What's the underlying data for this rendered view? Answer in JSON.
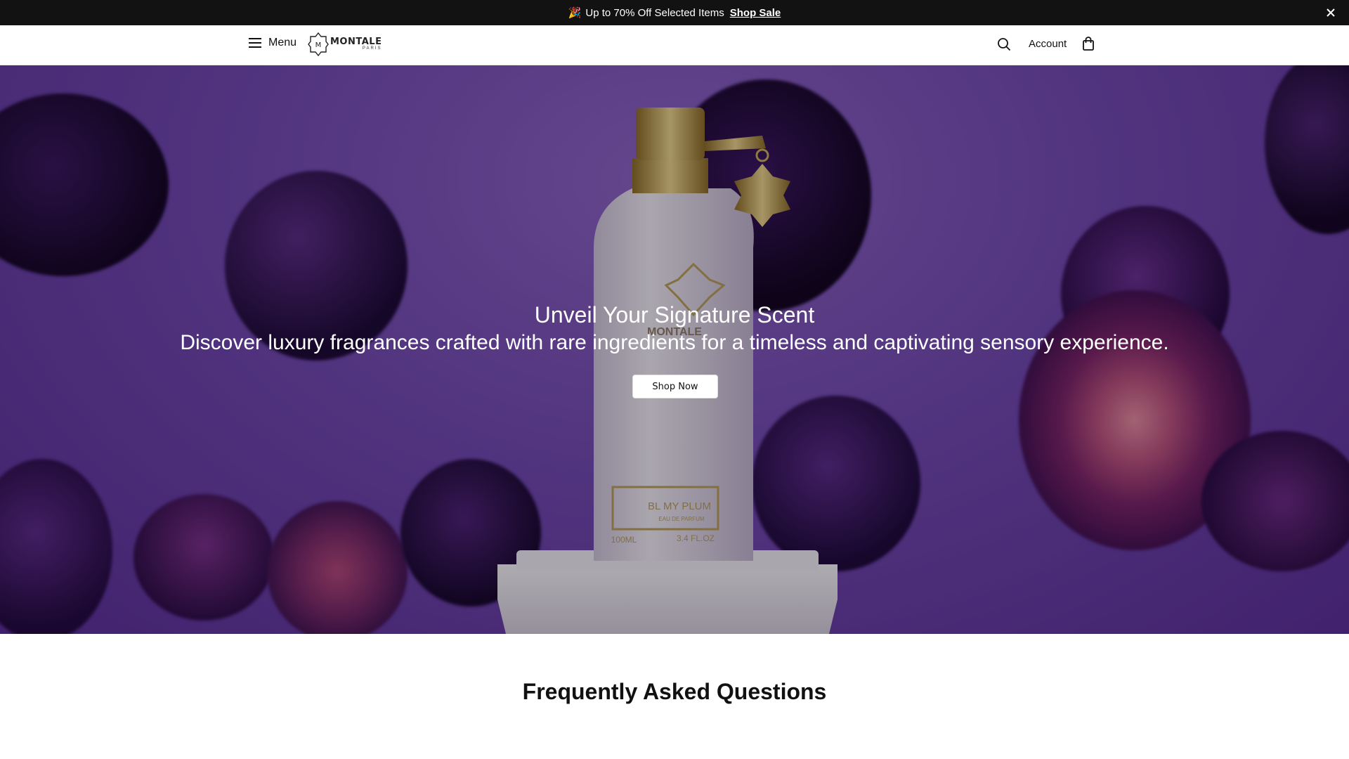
{
  "announcement": {
    "emoji": "🎉",
    "text": "Up to 70% Off Selected Items",
    "link_label": "Shop Sale",
    "close_icon": "close-icon"
  },
  "header": {
    "menu_label": "Menu",
    "logo_brand": "MONTALE",
    "logo_city": "PARIS",
    "account_label": "Account",
    "icons": [
      "hamburger-icon",
      "search-icon",
      "bag-icon"
    ]
  },
  "hero": {
    "title": "Unveil Your Signature Scent",
    "subtitle": "Discover luxury fragrances crafted with rare ingredients for a timeless and captivating sensory experience.",
    "cta_label": "Shop Now",
    "bottle_label": "BL MY PLUM",
    "bottle_sub": "EAU DE PARFUM",
    "bottle_volume_ml": "100ML",
    "bottle_volume_oz": "3.4 FL.OZ",
    "bottle_brand": "MONTALE"
  },
  "faq": {
    "title": "Frequently Asked Questions"
  },
  "colors": {
    "announcement_bg": "#121212",
    "hero_purple": "#7148b0",
    "plum_dark": "#2a0d4a"
  }
}
